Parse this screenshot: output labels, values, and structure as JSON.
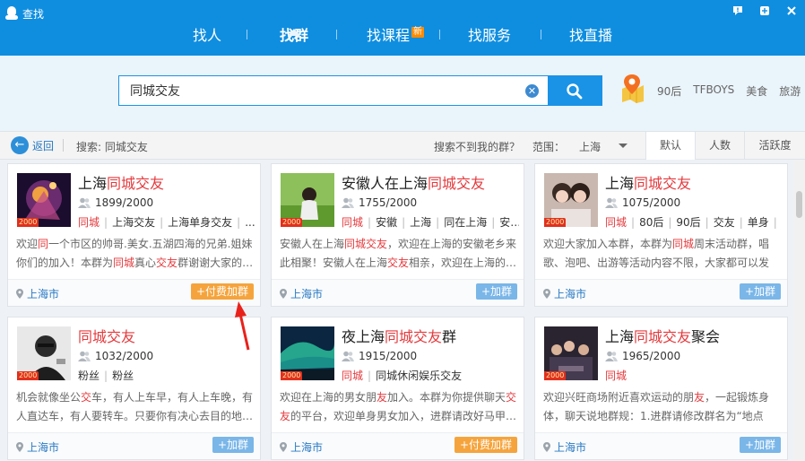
{
  "window": {
    "title": "查找"
  },
  "nav": {
    "items": [
      {
        "label": "找人",
        "active": false
      },
      {
        "label": "找群",
        "active": true
      },
      {
        "label": "找课程",
        "badge": "新",
        "active": false
      },
      {
        "label": "找服务",
        "active": false
      },
      {
        "label": "找直播",
        "active": false
      }
    ]
  },
  "search": {
    "value": "同城交友",
    "placeholder": ""
  },
  "hot_tags": [
    "90后",
    "TFBOYS",
    "美食",
    "旅游"
  ],
  "filter": {
    "back_label": "返回",
    "search_info": "搜索: 同城交友",
    "notfound_label": "搜索不到我的群？",
    "range_label": "范围：",
    "range_value": "上海",
    "sort_tabs": [
      {
        "label": "默认",
        "active": true
      },
      {
        "label": "人数",
        "active": false
      },
      {
        "label": "活跃度",
        "active": false
      }
    ]
  },
  "colors": {
    "accent": "#0f8ee0",
    "highlight": "#e4393c",
    "join": "#7ab6e8",
    "paid_join": "#f5a43d"
  },
  "level_tag": "2000",
  "cards": [
    {
      "name": [
        {
          "t": "上海",
          "h": false
        },
        {
          "t": "同城交友",
          "h": true
        }
      ],
      "members": "1899/2000",
      "tags": [
        "同城",
        "上海交友",
        "上海单身交友",
        "..."
      ],
      "desc": [
        {
          "t": "欢迎",
          "h": false
        },
        {
          "t": "同",
          "h": true
        },
        {
          "t": "一个市区的帅哥.美女.五湖四海的兄弟.姐妹你们的加入！本群为",
          "h": false
        },
        {
          "t": "同城",
          "h": true
        },
        {
          "t": "真心",
          "h": false
        },
        {
          "t": "交友",
          "h": true
        },
        {
          "t": "群谢谢大家的…",
          "h": false
        }
      ],
      "location": "上海市",
      "join_label": "+付费加群",
      "paid": true,
      "art": "a1"
    },
    {
      "name": [
        {
          "t": "安徽人在上海",
          "h": false
        },
        {
          "t": "同城交友",
          "h": true
        }
      ],
      "members": "1755/2000",
      "tags": [
        "同城",
        "安徽",
        "上海",
        "同在上海",
        "安…"
      ],
      "desc": [
        {
          "t": "安徽人在上海",
          "h": false
        },
        {
          "t": "同城交友",
          "h": true
        },
        {
          "t": "，欢迎在上海的安徽老乡来此相聚！安徽人在上海",
          "h": false
        },
        {
          "t": "交友",
          "h": true
        },
        {
          "t": "相亲，欢迎在上海的…",
          "h": false
        }
      ],
      "location": "上海市",
      "join_label": "+加群",
      "paid": false,
      "art": "a2"
    },
    {
      "name": [
        {
          "t": "上海",
          "h": false
        },
        {
          "t": "同城交友",
          "h": true
        }
      ],
      "members": "1075/2000",
      "tags": [
        "同城",
        "80后",
        "90后",
        "交友",
        "单身",
        "…"
      ],
      "desc": [
        {
          "t": "欢迎大家加入本群，本群为",
          "h": false
        },
        {
          "t": "同城",
          "h": true
        },
        {
          "t": "周末活动群，唱歌、泡吧、出游等活动内容不限，大家都可以发起…",
          "h": false
        }
      ],
      "location": "上海市",
      "join_label": "+加群",
      "paid": false,
      "art": "a3"
    },
    {
      "name": [
        {
          "t": "同城交友",
          "h": true
        }
      ],
      "members": "1032/2000",
      "tags": [
        "粉丝",
        "粉丝"
      ],
      "first_plain": true,
      "desc": [
        {
          "t": "机会就像坐公",
          "h": false
        },
        {
          "t": "交",
          "h": true
        },
        {
          "t": "车，有人上车早，有人上车晚，有人直达车，有人要转车。只要你有决心去目的地…",
          "h": false
        }
      ],
      "location": "上海市",
      "join_label": "+加群",
      "paid": false,
      "art": "a4"
    },
    {
      "name": [
        {
          "t": "夜上海",
          "h": false
        },
        {
          "t": "同城交友",
          "h": true
        },
        {
          "t": "群",
          "h": false
        }
      ],
      "members": "1915/2000",
      "tags": [
        "同城",
        "同城休闲娱乐交友"
      ],
      "desc": [
        {
          "t": "欢迎在上海的男女朋",
          "h": false
        },
        {
          "t": "友",
          "h": true
        },
        {
          "t": "加入。本群为你提供聊天",
          "h": false
        },
        {
          "t": "交友",
          "h": true
        },
        {
          "t": "的平台，欢迎单身男女加入，进群请改好马甲…",
          "h": false
        }
      ],
      "location": "上海市",
      "join_label": "+付费加群",
      "paid": true,
      "art": "a5"
    },
    {
      "name": [
        {
          "t": "上海",
          "h": false
        },
        {
          "t": "同城交友",
          "h": true
        },
        {
          "t": "聚会",
          "h": false
        }
      ],
      "members": "1965/2000",
      "tags": [
        "同城"
      ],
      "desc": [
        {
          "t": "欢迎兴旺商场附近喜欢运动的朋",
          "h": false
        },
        {
          "t": "友",
          "h": true
        },
        {
          "t": "，一起锻炼身体，聊天说地群规：1.进群请修改群名为“地点+昵…",
          "h": false
        }
      ],
      "location": "上海市",
      "join_label": "+加群",
      "paid": false,
      "art": "a6"
    }
  ]
}
